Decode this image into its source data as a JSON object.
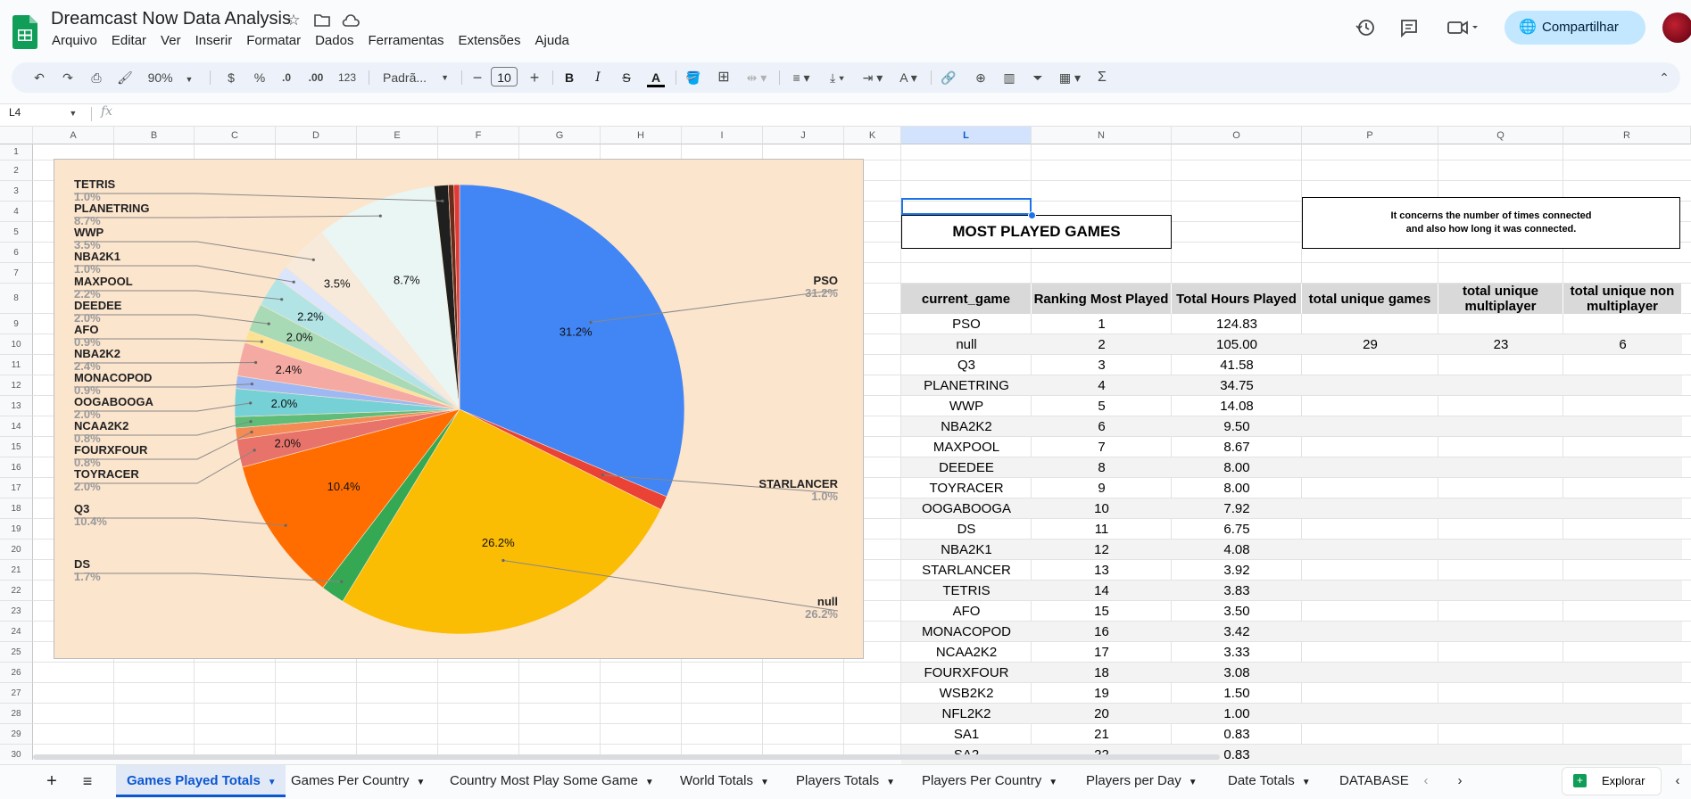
{
  "app": {
    "title": "Dreamcast Now Data Analysis",
    "share_label": "Compartilhar",
    "menus": [
      "Arquivo",
      "Editar",
      "Ver",
      "Inserir",
      "Formatar",
      "Dados",
      "Ferramentas",
      "Extensões",
      "Ajuda"
    ]
  },
  "toolbar": {
    "zoom": "90%",
    "currency": "$",
    "percent": "%",
    "dec_decrease": ".0",
    "dec_increase": ".00",
    "number_format": "123",
    "font": "Padrã...",
    "font_size": "10",
    "bold": "B",
    "italic": "I",
    "strike": "S",
    "text_color": "A",
    "sum": "Σ"
  },
  "formula_bar": {
    "cell_ref": "L4",
    "fx": "fx"
  },
  "columns": [
    "A",
    "B",
    "C",
    "D",
    "E",
    "F",
    "G",
    "H",
    "I",
    "J",
    "K",
    "L",
    "N",
    "O",
    "P",
    "Q",
    "R"
  ],
  "selected_column": "L",
  "rows": [
    "1",
    "2",
    "3",
    "4",
    "5",
    "6",
    "7",
    "8",
    "9",
    "10",
    "11",
    "12",
    "13",
    "14",
    "15",
    "16",
    "17",
    "18",
    "19",
    "20",
    "21",
    "22",
    "23",
    "24",
    "25",
    "26",
    "27",
    "28",
    "29",
    "30"
  ],
  "table": {
    "title": "MOST PLAYED GAMES",
    "note_line1": "It concerns the number of times connected",
    "note_line2": "and also how long it was connected.",
    "headers": [
      "current_game",
      "Ranking Most Played",
      "Total Hours Played",
      "total unique games",
      "total unique multiplayer",
      "total unique non multiplayer"
    ],
    "summary": {
      "total_unique_games": "29",
      "total_unique_multiplayer": "23",
      "total_unique_non_multiplayer": "6"
    },
    "rows": [
      {
        "game": "PSO",
        "rank": "1",
        "hours": "124.83"
      },
      {
        "game": "null",
        "rank": "2",
        "hours": "105.00"
      },
      {
        "game": "Q3",
        "rank": "3",
        "hours": "41.58"
      },
      {
        "game": "PLANETRING",
        "rank": "4",
        "hours": "34.75"
      },
      {
        "game": "WWP",
        "rank": "5",
        "hours": "14.08"
      },
      {
        "game": "NBA2K2",
        "rank": "6",
        "hours": "9.50"
      },
      {
        "game": "MAXPOOL",
        "rank": "7",
        "hours": "8.67"
      },
      {
        "game": "DEEDEE",
        "rank": "8",
        "hours": "8.00"
      },
      {
        "game": "TOYRACER",
        "rank": "9",
        "hours": "8.00"
      },
      {
        "game": "OOGABOOGA",
        "rank": "10",
        "hours": "7.92"
      },
      {
        "game": "DS",
        "rank": "11",
        "hours": "6.75"
      },
      {
        "game": "NBA2K1",
        "rank": "12",
        "hours": "4.08"
      },
      {
        "game": "STARLANCER",
        "rank": "13",
        "hours": "3.92"
      },
      {
        "game": "TETRIS",
        "rank": "14",
        "hours": "3.83"
      },
      {
        "game": "AFO",
        "rank": "15",
        "hours": "3.50"
      },
      {
        "game": "MONACOPOD",
        "rank": "16",
        "hours": "3.42"
      },
      {
        "game": "NCAA2K2",
        "rank": "17",
        "hours": "3.33"
      },
      {
        "game": "FOURXFOUR",
        "rank": "18",
        "hours": "3.08"
      },
      {
        "game": "WSB2K2",
        "rank": "19",
        "hours": "1.50"
      },
      {
        "game": "NFL2K2",
        "rank": "20",
        "hours": "1.00"
      },
      {
        "game": "SA1",
        "rank": "21",
        "hours": "0.83"
      },
      {
        "game": "SA2",
        "rank": "22",
        "hours": "0.83"
      }
    ]
  },
  "chart_data": {
    "type": "pie",
    "start_angle_deg": 0,
    "direction": "clockwise",
    "slices": [
      {
        "name": "PSO",
        "label_pct": "31.2%",
        "inner_pct": "31.2%",
        "value": 31.2,
        "color": "#4285f4"
      },
      {
        "name": "STARLANCER",
        "label_pct": "1.0%",
        "inner_pct": "",
        "value": 1.0,
        "color": "#ea4335"
      },
      {
        "name": "null",
        "label_pct": "26.2%",
        "inner_pct": "26.2%",
        "value": 26.2,
        "color": "#fbbc04"
      },
      {
        "name": "DS",
        "label_pct": "1.7%",
        "inner_pct": "",
        "value": 1.7,
        "color": "#34a853"
      },
      {
        "name": "Q3",
        "label_pct": "10.4%",
        "inner_pct": "10.4%",
        "value": 10.4,
        "color": "#ff6d01"
      },
      {
        "name": "TOYRACER",
        "label_pct": "2.0%",
        "inner_pct": "2.0%",
        "value": 2.0,
        "color": "#e8736b"
      },
      {
        "name": "FOURXFOUR",
        "label_pct": "0.8%",
        "inner_pct": "",
        "value": 0.8,
        "color": "#f48a54"
      },
      {
        "name": "NCAA2K2",
        "label_pct": "0.8%",
        "inner_pct": "",
        "value": 0.8,
        "color": "#60bd79"
      },
      {
        "name": "OOGABOOGA",
        "label_pct": "2.0%",
        "inner_pct": "2.0%",
        "value": 2.0,
        "color": "#76d1d6"
      },
      {
        "name": "MONACOPOD",
        "label_pct": "0.9%",
        "inner_pct": "",
        "value": 0.9,
        "color": "#9db8f2"
      },
      {
        "name": "NBA2K2",
        "label_pct": "2.4%",
        "inner_pct": "2.4%",
        "value": 2.4,
        "color": "#f5a9a3"
      },
      {
        "name": "AFO",
        "label_pct": "0.9%",
        "inner_pct": "",
        "value": 0.9,
        "color": "#fde293"
      },
      {
        "name": "DEEDEE",
        "label_pct": "2.0%",
        "inner_pct": "2.0%",
        "value": 2.0,
        "color": "#a8dab5"
      },
      {
        "name": "MAXPOOL",
        "label_pct": "2.2%",
        "inner_pct": "2.2%",
        "value": 2.2,
        "color": "#b2e4e6"
      },
      {
        "name": "NBA2K1",
        "label_pct": "1.0%",
        "inner_pct": "",
        "value": 1.0,
        "color": "#dbe5fb"
      },
      {
        "name": "WWP",
        "label_pct": "3.5%",
        "inner_pct": "3.5%",
        "value": 3.5,
        "color": "#f7eadb"
      },
      {
        "name": "PLANETRING",
        "label_pct": "8.7%",
        "inner_pct": "8.7%",
        "value": 8.7,
        "color": "#eaf6f4"
      },
      {
        "name": "TETRIS",
        "label_pct": "1.0%",
        "inner_pct": "",
        "value": 1.0,
        "color": "#1f1f1f"
      },
      {
        "name": "",
        "label_pct": "",
        "inner_pct": "",
        "value": 0.4,
        "color": "#6b2b1a"
      },
      {
        "name": "",
        "label_pct": "",
        "inner_pct": "",
        "value": 0.4,
        "color": "#e53935"
      }
    ]
  },
  "tabs": [
    "Games Played Totals",
    "Games Per Country",
    "Country Most Play Some Game",
    "World Totals",
    "Players Totals",
    "Players Per Country",
    "Players per Day",
    "Date Totals",
    "DATABASE"
  ],
  "active_tab": "Games Played Totals",
  "explore_label": "Explorar",
  "icons": {
    "add_sheet": "plus-icon",
    "all_sheets": "menu-icon",
    "history": "history-icon",
    "comments": "comment-icon",
    "meet": "video-icon"
  }
}
